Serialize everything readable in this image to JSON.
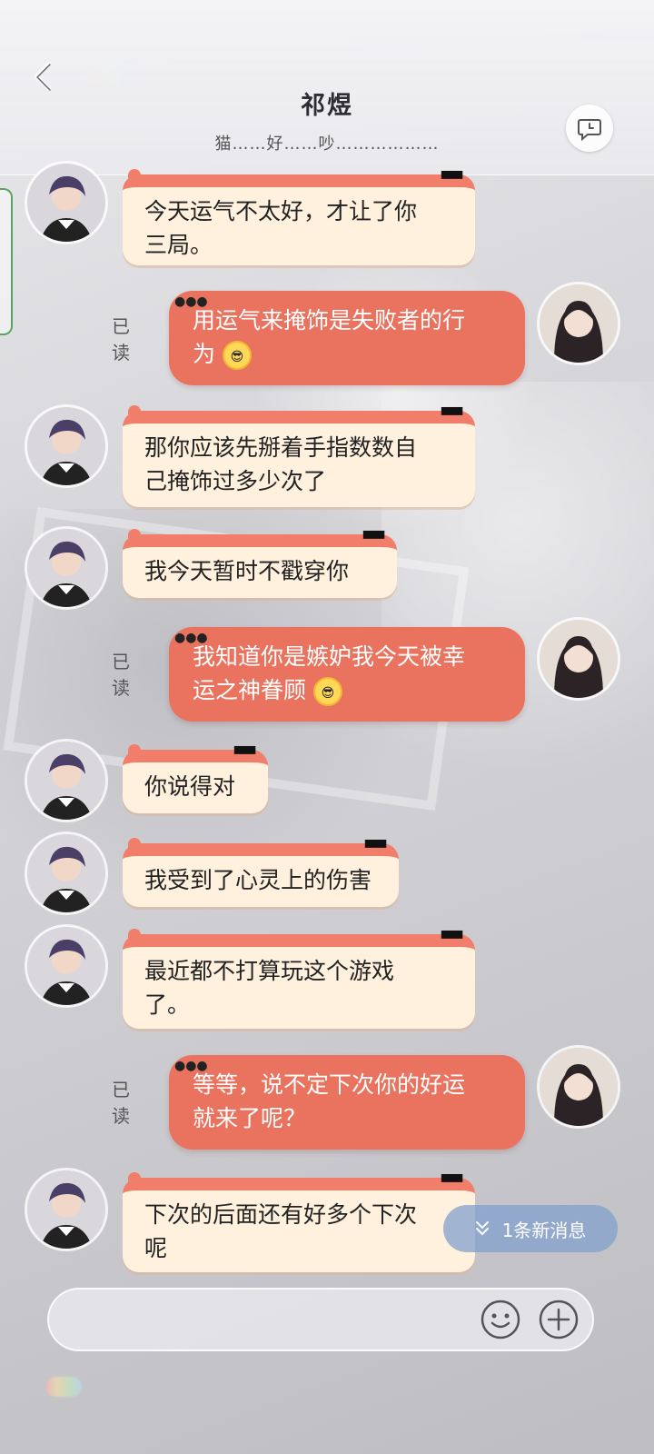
{
  "header": {
    "title": "祁煜",
    "subtitle": "猫……好……吵………………"
  },
  "icons": {
    "back": "chevron-left-icon",
    "history": "chat-history-clock-icon",
    "emoji": "smiley-face-icon",
    "plus": "plus-icon",
    "new_message_arrow": "double-chevron-down-icon"
  },
  "colors": {
    "incoming_bubble": "#fff1dd",
    "incoming_trim": "#f07e6a",
    "outgoing_bubble": "#e9735f",
    "new_message_pill": "#82a0cd"
  },
  "messages": [
    {
      "from": "contact",
      "lines": [
        "今天运气不太好，才让了你",
        "三局。"
      ]
    },
    {
      "from": "me",
      "read_label": "已读",
      "lines": [
        "用运气来掩饰是失败者的行",
        "为"
      ],
      "emoji": "sunglasses-emoji"
    },
    {
      "from": "contact",
      "lines": [
        "那你应该先掰着手指数数自",
        "己掩饰过多少次了"
      ]
    },
    {
      "from": "contact",
      "lines": [
        "我今天暂时不戳穿你"
      ]
    },
    {
      "from": "me",
      "read_label": "已读",
      "lines": [
        "我知道你是嫉妒我今天被幸",
        "运之神眷顾"
      ],
      "emoji": "sunglasses-emoji"
    },
    {
      "from": "contact",
      "lines": [
        "你说得对"
      ]
    },
    {
      "from": "contact",
      "lines": [
        "我受到了心灵上的伤害"
      ]
    },
    {
      "from": "contact",
      "lines": [
        "最近都不打算玩这个游戏",
        "了。"
      ]
    },
    {
      "from": "me",
      "read_label": "已读",
      "lines": [
        "等等，说不定下次你的好运",
        "就来了呢？"
      ]
    },
    {
      "from": "contact",
      "lines": [
        "下次的后面还有好多个下次",
        "呢"
      ]
    }
  ],
  "new_messages": {
    "label": "1条新消息"
  },
  "composer": {
    "value": "",
    "placeholder": ""
  }
}
